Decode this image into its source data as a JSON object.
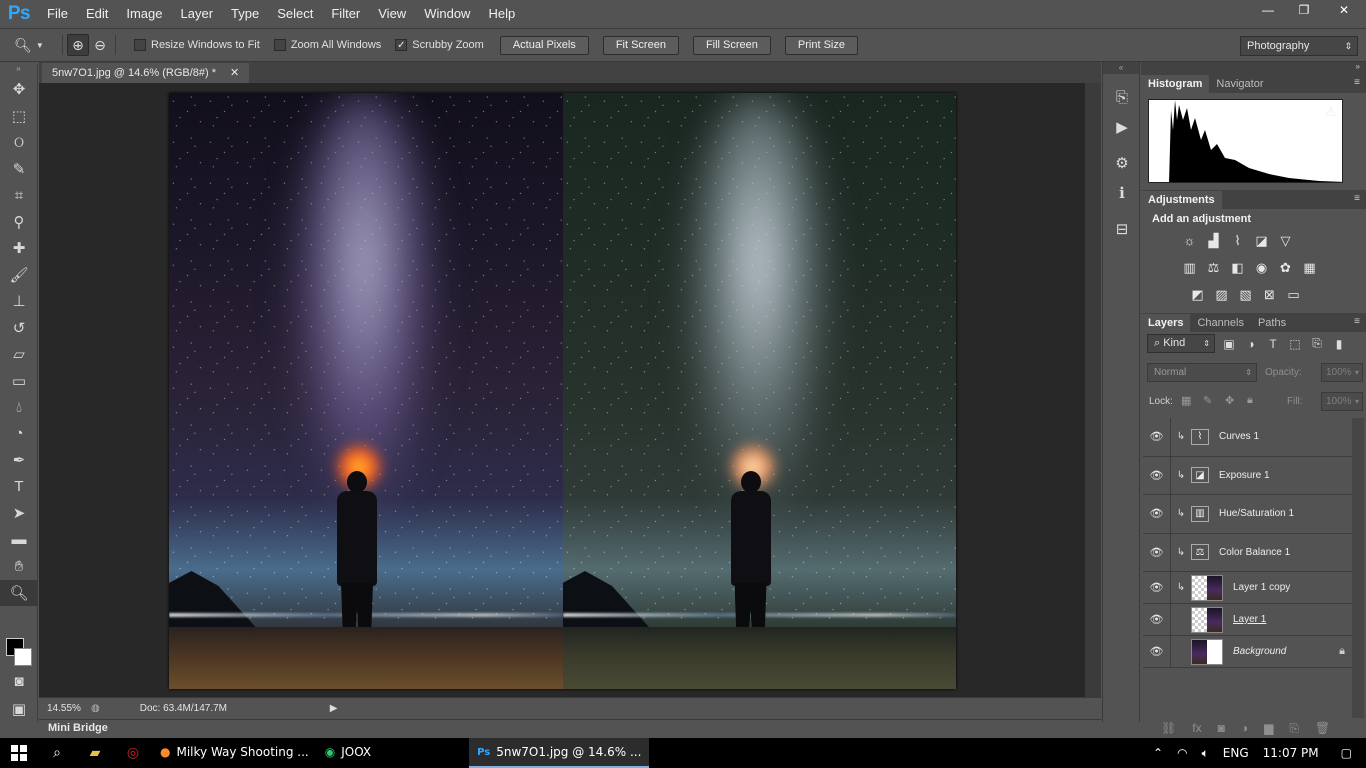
{
  "app": {
    "logo": "Ps",
    "menu": [
      "File",
      "Edit",
      "Image",
      "Layer",
      "Type",
      "Select",
      "Filter",
      "View",
      "Window",
      "Help"
    ],
    "window_controls": {
      "minimize": "—",
      "restore": "❐",
      "close": "✕"
    }
  },
  "options_bar": {
    "resize_windows": {
      "label": "Resize Windows to Fit",
      "checked": false
    },
    "zoom_all": {
      "label": "Zoom All Windows",
      "checked": false
    },
    "scrubby_zoom": {
      "label": "Scrubby Zoom",
      "checked": true
    },
    "buttons": [
      "Actual Pixels",
      "Fit Screen",
      "Fill Screen",
      "Print Size"
    ],
    "workspace": "Photography"
  },
  "document": {
    "tab_title": "5nw7O1.jpg @ 14.6% (RGB/8#) *",
    "zoom": "14.55%",
    "doc_info": "Doc: 63.4M/147.7M"
  },
  "mini_bridge": "Mini Bridge",
  "panels": {
    "histogram_tabs": [
      "Histogram",
      "Navigator"
    ],
    "adjustments_title": "Adjustments",
    "add_adjustment": "Add an adjustment",
    "layers_tabs": [
      "Layers",
      "Channels",
      "Paths"
    ],
    "kind": "Kind",
    "blend_mode": "Normal",
    "opacity_label": "Opacity:",
    "opacity_value": "100%",
    "lock_label": "Lock:",
    "fill_label": "Fill:",
    "fill_value": "100%"
  },
  "layers": [
    {
      "name": "Curves 1",
      "type": "adjustment",
      "icon": "curves-icon"
    },
    {
      "name": "Exposure 1",
      "type": "adjustment",
      "icon": "exposure-icon"
    },
    {
      "name": "Hue/Saturation 1",
      "type": "adjustment",
      "icon": "hue-saturation-icon"
    },
    {
      "name": "Color Balance 1",
      "type": "adjustment",
      "icon": "color-balance-icon"
    },
    {
      "name": "Layer 1 copy",
      "type": "pixel"
    },
    {
      "name": "Layer 1",
      "type": "pixel"
    },
    {
      "name": "Background",
      "type": "background",
      "locked": true
    }
  ],
  "taskbar": {
    "tasks": [
      {
        "label": "Milky Way Shooting ...",
        "icon": "firefox-icon"
      },
      {
        "label": "JOOX",
        "icon": "joox-icon"
      },
      {
        "label": "5nw7O1.jpg @ 14.6% ...",
        "icon": "photoshop-icon"
      }
    ],
    "lang": "ENG",
    "time": "11:07 PM"
  }
}
